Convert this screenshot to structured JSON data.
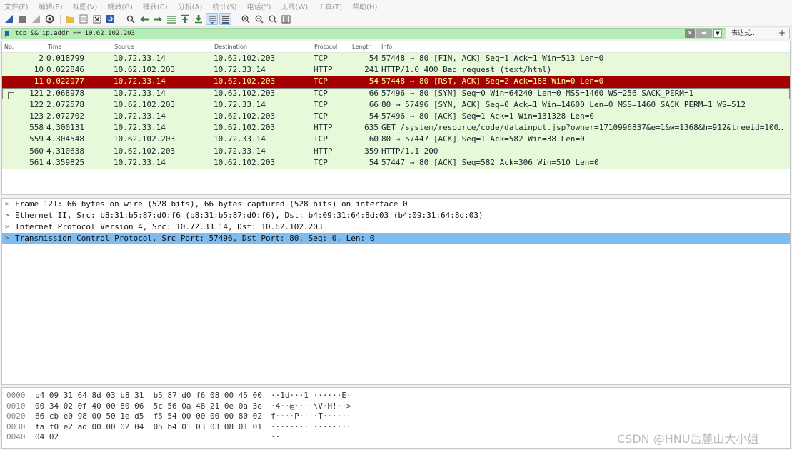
{
  "menu": [
    "文件(F)",
    "编辑(E)",
    "视图(V)",
    "跳转(G)",
    "捕获(C)",
    "分析(A)",
    "统计(S)",
    "电话(Y)",
    "无线(W)",
    "工具(T)",
    "帮助(H)"
  ],
  "filter": {
    "value": "tcp && ip.addr == 10.62.102.203",
    "expression_label": "表达式…",
    "plus_label": "+"
  },
  "columns": {
    "no": "No.",
    "time": "Time",
    "source": "Source",
    "destination": "Destination",
    "protocol": "Protocol",
    "length": "Length",
    "info": "Info"
  },
  "packets": [
    {
      "no": "2",
      "time": "0.018799",
      "src": "10.72.33.14",
      "dst": "10.62.102.203",
      "proto": "TCP",
      "len": "54",
      "info": "57448 → 80 [FIN, ACK] Seq=1 Ack=1 Win=513 Len=0"
    },
    {
      "no": "10",
      "time": "0.022846",
      "src": "10.62.102.203",
      "dst": "10.72.33.14",
      "proto": "HTTP",
      "len": "241",
      "info": "HTTP/1.0 400 Bad request  (text/html)"
    },
    {
      "no": "11",
      "time": "0.022977",
      "src": "10.72.33.14",
      "dst": "10.62.102.203",
      "proto": "TCP",
      "len": "54",
      "info": "57448 → 80 [RST, ACK] Seq=2 Ack=188 Win=0 Len=0"
    },
    {
      "no": "121",
      "time": "2.068978",
      "src": "10.72.33.14",
      "dst": "10.62.102.203",
      "proto": "TCP",
      "len": "66",
      "info": "57496 → 80 [SYN] Seq=0 Win=64240 Len=0 MSS=1460 WS=256 SACK_PERM=1"
    },
    {
      "no": "122",
      "time": "2.072578",
      "src": "10.62.102.203",
      "dst": "10.72.33.14",
      "proto": "TCP",
      "len": "66",
      "info": "80 → 57496 [SYN, ACK] Seq=0 Ack=1 Win=14600 Len=0 MSS=1460 SACK_PERM=1 WS=512"
    },
    {
      "no": "123",
      "time": "2.072702",
      "src": "10.72.33.14",
      "dst": "10.62.102.203",
      "proto": "TCP",
      "len": "54",
      "info": "57496 → 80 [ACK] Seq=1 Ack=1 Win=131328 Len=0"
    },
    {
      "no": "558",
      "time": "4.300131",
      "src": "10.72.33.14",
      "dst": "10.62.102.203",
      "proto": "HTTP",
      "len": "635",
      "info": "GET /system/resource/code/datainput.jsp?owner=1710996837&e=1&w=1368&h=912&treeid=100…"
    },
    {
      "no": "559",
      "time": "4.304548",
      "src": "10.62.102.203",
      "dst": "10.72.33.14",
      "proto": "TCP",
      "len": "60",
      "info": "80 → 57447 [ACK] Seq=1 Ack=582 Win=38 Len=0"
    },
    {
      "no": "560",
      "time": "4.310638",
      "src": "10.62.102.203",
      "dst": "10.72.33.14",
      "proto": "HTTP",
      "len": "359",
      "info": "HTTP/1.1 200"
    },
    {
      "no": "561",
      "time": "4.359825",
      "src": "10.72.33.14",
      "dst": "10.62.102.203",
      "proto": "TCP",
      "len": "54",
      "info": "57447 → 80 [ACK] Seq=582 Ack=306 Win=510 Len=0"
    }
  ],
  "details": [
    "Frame 121: 66 bytes on wire (528 bits), 66 bytes captured (528 bits) on interface 0",
    "Ethernet II, Src: b8:31:b5:87:d0:f6 (b8:31:b5:87:d0:f6), Dst: b4:09:31:64:8d:03 (b4:09:31:64:8d:03)",
    "Internet Protocol Version 4, Src: 10.72.33.14, Dst: 10.62.102.203",
    "Transmission Control Protocol, Src Port: 57496, Dst Port: 80, Seq: 0, Len: 0"
  ],
  "bytes": [
    {
      "offset": "0000",
      "hex": "b4 09 31 64 8d 03 b8 31  b5 87 d0 f6 08 00 45 00",
      "ascii": "··1d···1 ······E·"
    },
    {
      "offset": "0010",
      "hex": "00 34 02 0f 40 00 80 06  5c 56 0a 48 21 0e 0a 3e",
      "ascii": "·4··@··· \\V·H!··>"
    },
    {
      "offset": "0020",
      "hex": "66 cb e0 98 00 50 1e d5  f5 54 00 00 00 00 80 02",
      "ascii": "f····P·· ·T······"
    },
    {
      "offset": "0030",
      "hex": "fa f0 e2 ad 00 00 02 04  05 b4 01 03 03 08 01 01",
      "ascii": "········ ········"
    },
    {
      "offset": "0040",
      "hex": "04 02",
      "ascii": "··"
    }
  ],
  "watermark": "CSDN @HNU岳麓山大小姐",
  "colors": {
    "tcp_row": "#e8f9d9",
    "bad_row": "#a40000",
    "bad_row_text": "#fffc9c",
    "selected_detail": "#7fbcf0",
    "filter_valid": "#b5ecb5"
  }
}
